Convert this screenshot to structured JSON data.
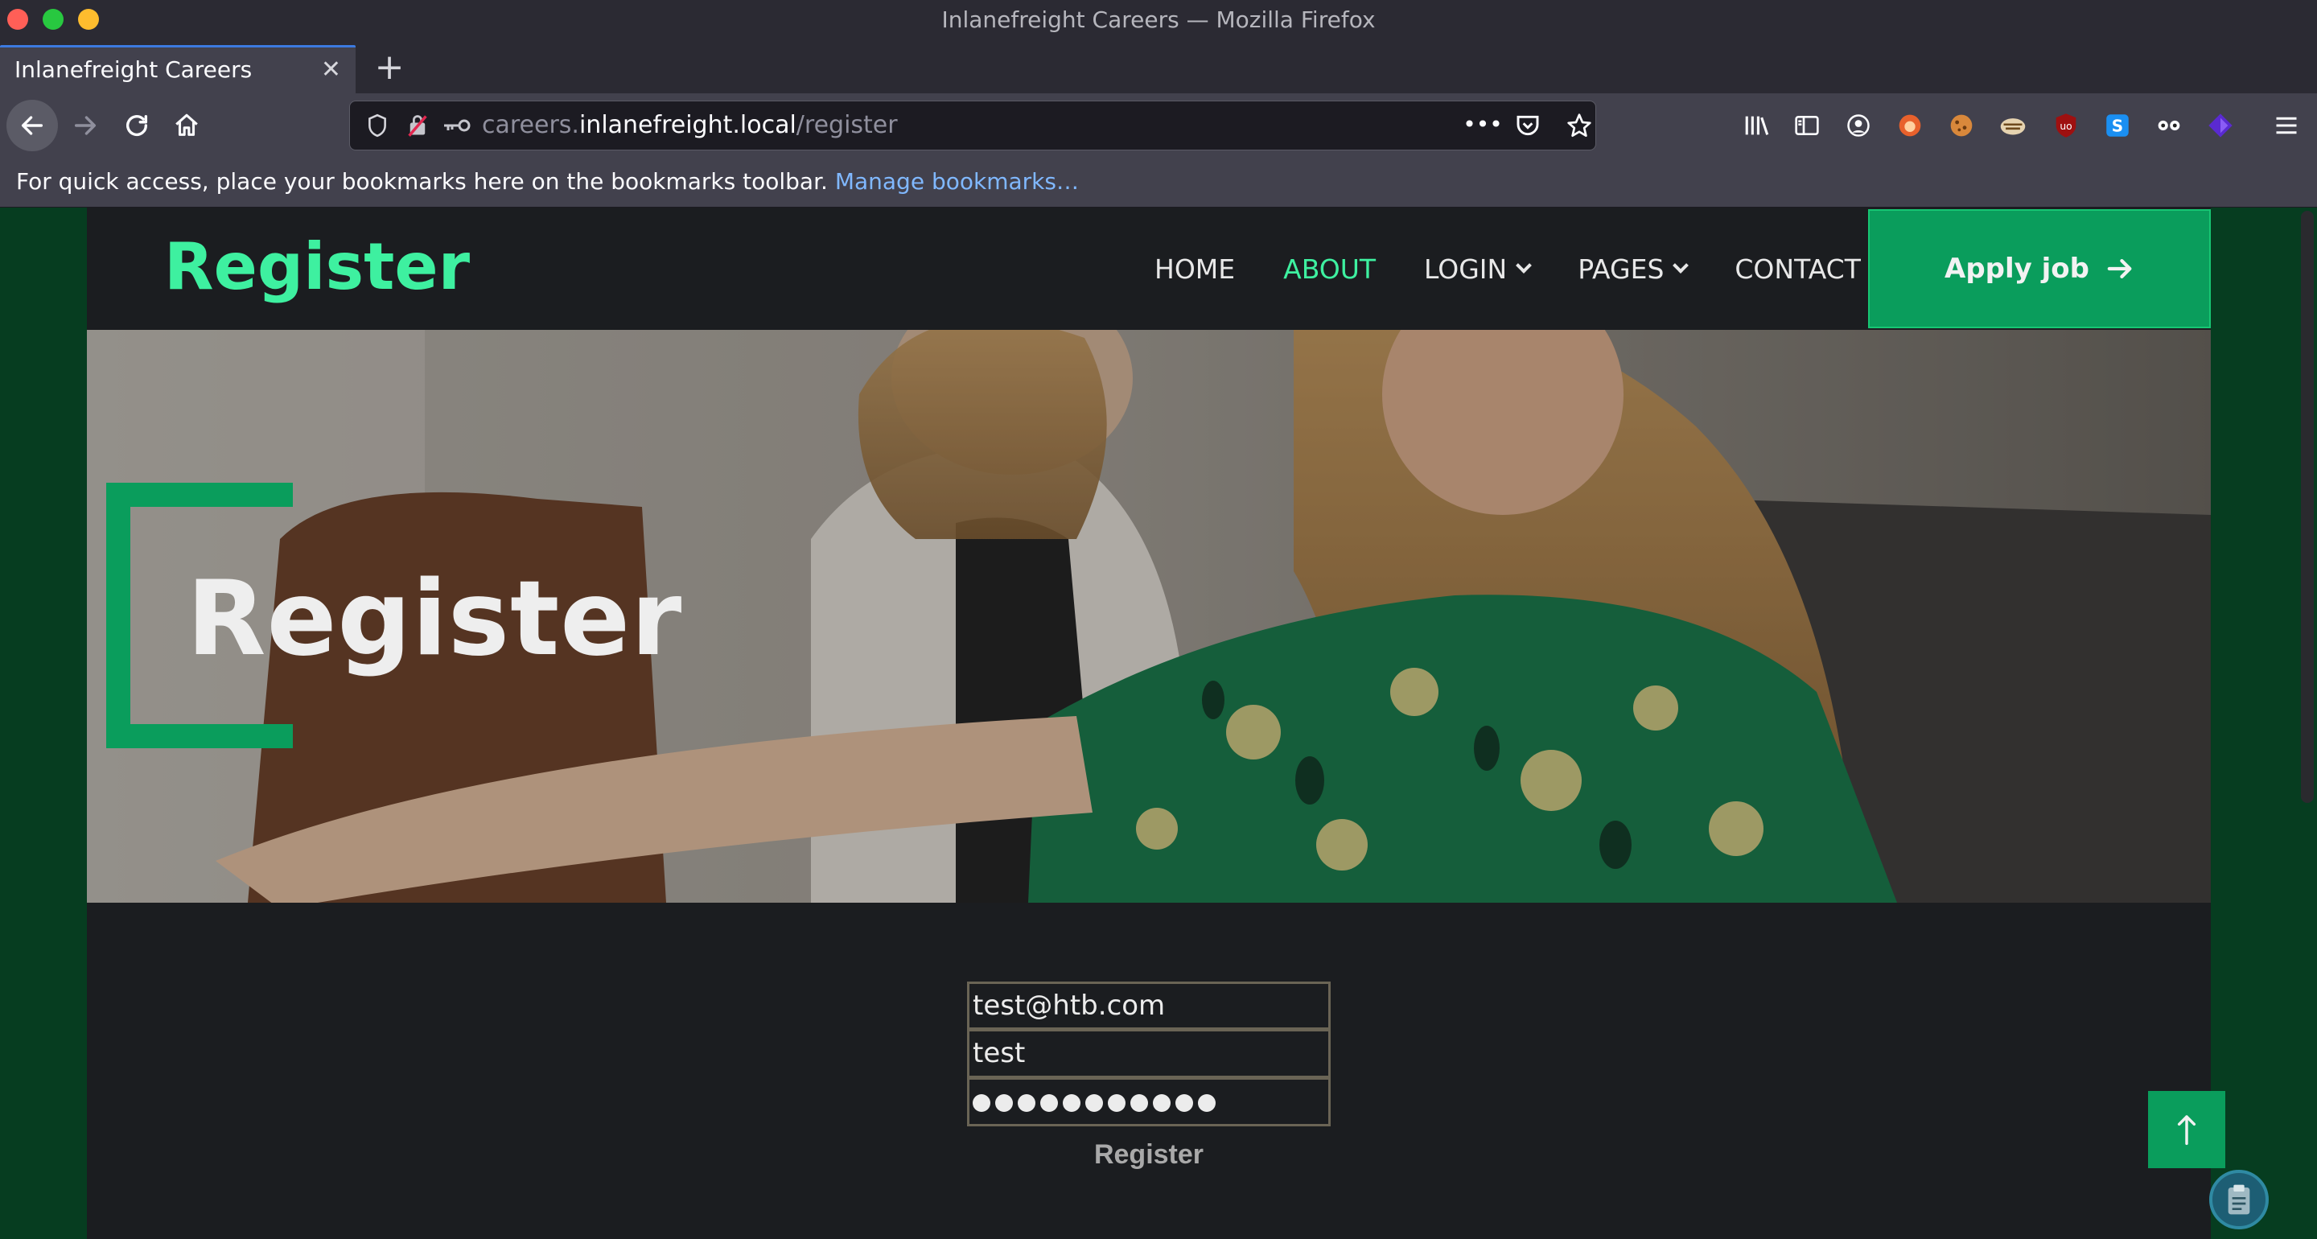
{
  "window": {
    "title": "Inlanefreight Careers — Mozilla Firefox"
  },
  "tabs": [
    {
      "title": "Inlanefreight Careers",
      "close": "✕"
    }
  ],
  "newtab_label": "+",
  "urlbar": {
    "prefix": "careers.",
    "domain": "inlanefreight.local",
    "path": "/register",
    "more": "•••"
  },
  "bookmarks_bar": {
    "text": "For quick access, place your bookmarks here on the bookmarks toolbar. ",
    "link": "Manage bookmarks…"
  },
  "site": {
    "logo": "Register",
    "nav": [
      {
        "label": "HOME"
      },
      {
        "label": "ABOUT"
      },
      {
        "label": "LOGIN"
      },
      {
        "label": "PAGES"
      },
      {
        "label": "CONTACT"
      }
    ],
    "apply_label": "Apply job",
    "hero_title": "Register"
  },
  "form": {
    "email_value": "test@htb.com",
    "username_value": "test",
    "password_mask_count": 11,
    "submit_label": "Register"
  },
  "colors": {
    "accent": "#3ef0a0",
    "button_green": "#0a9d5c",
    "page_bg": "#063d20",
    "header_bg": "#1b1d20"
  },
  "icons": {
    "back": "back-arrow-icon",
    "forward": "forward-arrow-icon",
    "reload": "reload-icon",
    "home": "home-icon",
    "to_top": "arrow-up-icon",
    "clipboard": "clipboard-icon"
  }
}
